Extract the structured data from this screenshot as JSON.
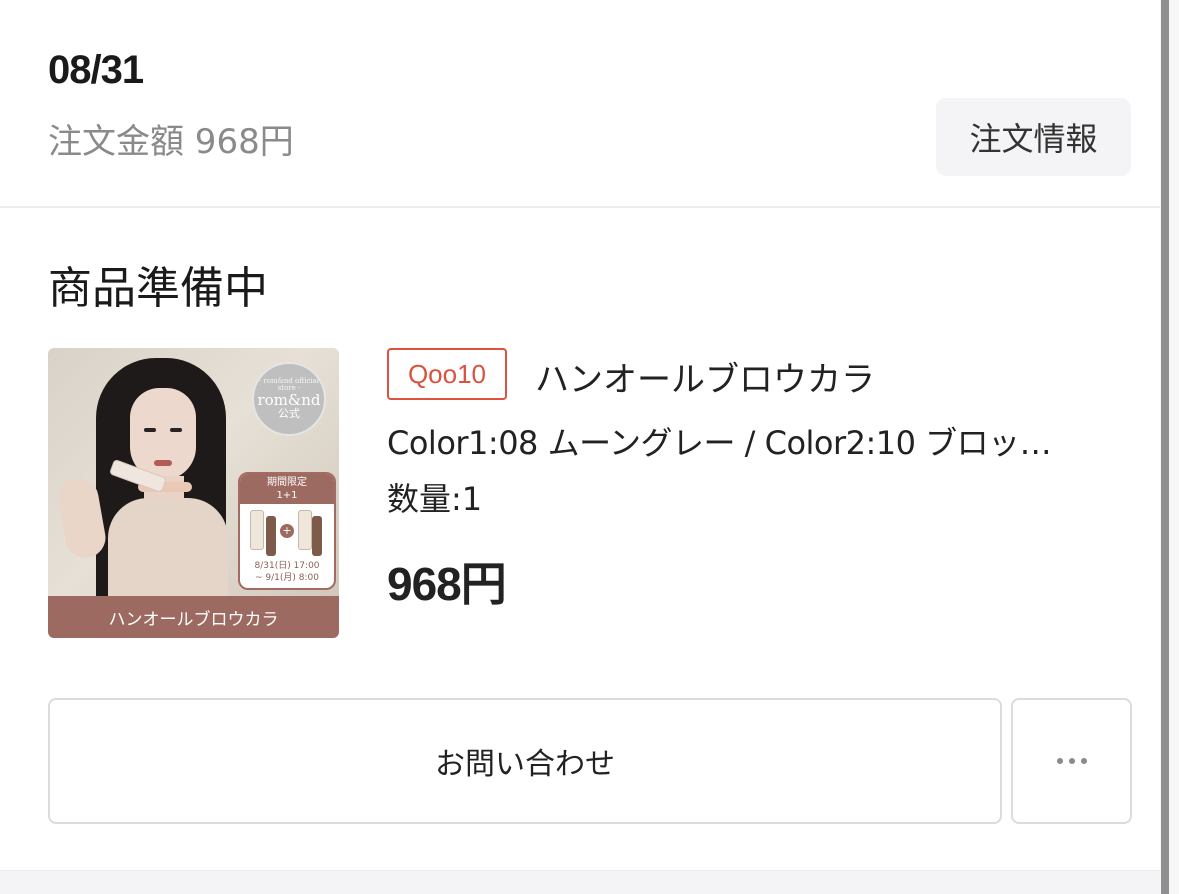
{
  "order": {
    "date": "08/31",
    "amount_text": "注文金額 968円",
    "info_button_label": "注文情報"
  },
  "status": {
    "title": "商品準備中"
  },
  "product": {
    "image": {
      "badge_sub": "· rom&nd official store ·",
      "badge_brand": "rom&nd",
      "badge_koshiki": "公式",
      "promo_line1": "期間限定",
      "promo_line2": "1+1",
      "promo_plus": "+",
      "promo_date_line1": "8/31(日) 17:00",
      "promo_date_line2": "~ 9/1(月) 8:00",
      "footer_text": "ハンオールブロウカラ"
    },
    "seller_badge": "Qoo10",
    "name": "ハンオールブロウカラ",
    "option": "Color1:08 ムーングレー / Color2:10 ブロッ…",
    "quantity": "数量:1",
    "price": "968円"
  },
  "actions": {
    "contact_label": "お問い合わせ",
    "more_icon": "more-horizontal-icon"
  },
  "colors": {
    "seller_badge": "#d9533e",
    "promo_brown": "#9d6a61"
  }
}
